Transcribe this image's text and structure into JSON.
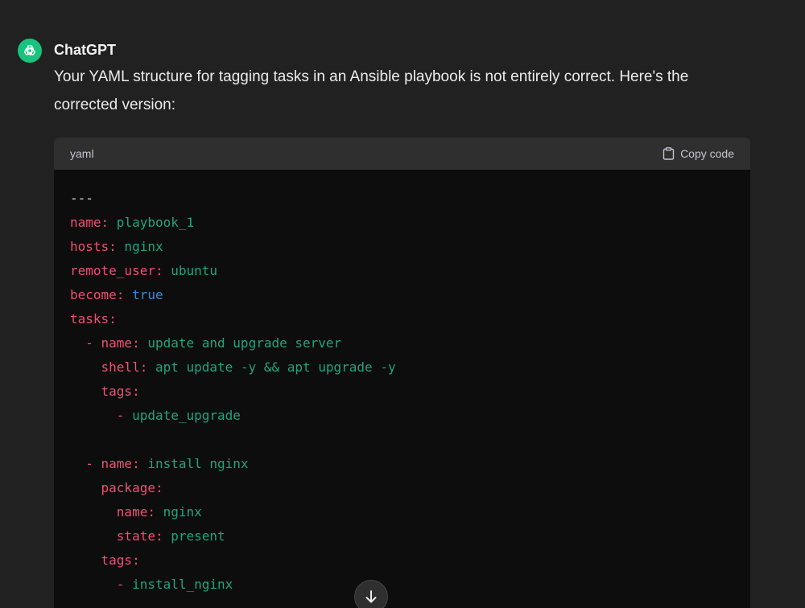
{
  "message": {
    "author": "ChatGPT",
    "text": "Your YAML structure for tagging tasks in an Ansible playbook is not entirely correct. Here's the corrected version:"
  },
  "code_block": {
    "language": "yaml",
    "copy_label": "Copy code",
    "lines": [
      [
        {
          "t": "---",
          "c": "d"
        }
      ],
      [
        {
          "t": "name:",
          "c": "k"
        },
        {
          "t": " playbook_1",
          "c": "s"
        }
      ],
      [
        {
          "t": "hosts:",
          "c": "k"
        },
        {
          "t": " nginx",
          "c": "s"
        }
      ],
      [
        {
          "t": "remote_user:",
          "c": "k"
        },
        {
          "t": " ubuntu",
          "c": "s"
        }
      ],
      [
        {
          "t": "become:",
          "c": "k"
        },
        {
          "t": " ",
          "c": "d"
        },
        {
          "t": "true",
          "c": "b"
        }
      ],
      [
        {
          "t": "tasks:",
          "c": "k"
        }
      ],
      [
        {
          "t": "  - ",
          "c": "k"
        },
        {
          "t": "name:",
          "c": "k"
        },
        {
          "t": " update and upgrade server",
          "c": "s"
        }
      ],
      [
        {
          "t": "    shell:",
          "c": "k"
        },
        {
          "t": " apt update -y && apt upgrade -y",
          "c": "s"
        }
      ],
      [
        {
          "t": "    tags:",
          "c": "k"
        }
      ],
      [
        {
          "t": "      - ",
          "c": "k"
        },
        {
          "t": "update_upgrade",
          "c": "s"
        }
      ],
      [],
      [
        {
          "t": "  - ",
          "c": "k"
        },
        {
          "t": "name:",
          "c": "k"
        },
        {
          "t": " install nginx",
          "c": "s"
        }
      ],
      [
        {
          "t": "    package:",
          "c": "k"
        }
      ],
      [
        {
          "t": "      name:",
          "c": "k"
        },
        {
          "t": " nginx",
          "c": "s"
        }
      ],
      [
        {
          "t": "      state:",
          "c": "k"
        },
        {
          "t": " present",
          "c": "s"
        }
      ],
      [
        {
          "t": "    tags:",
          "c": "k"
        }
      ],
      [
        {
          "t": "      - ",
          "c": "k"
        },
        {
          "t": "install_nginx",
          "c": "s"
        }
      ]
    ]
  },
  "icons": {
    "avatar": "openai-logo-icon",
    "copy": "clipboard-icon",
    "scroll": "arrow-down-icon"
  },
  "colors": {
    "background": "#212121",
    "avatar": "#19c37d",
    "code_background": "#0d0d0d",
    "code_header": "#2f2f2f",
    "yaml_key": "#ef4f75",
    "yaml_string": "#1fa57b",
    "yaml_boolean": "#3b8be0"
  }
}
